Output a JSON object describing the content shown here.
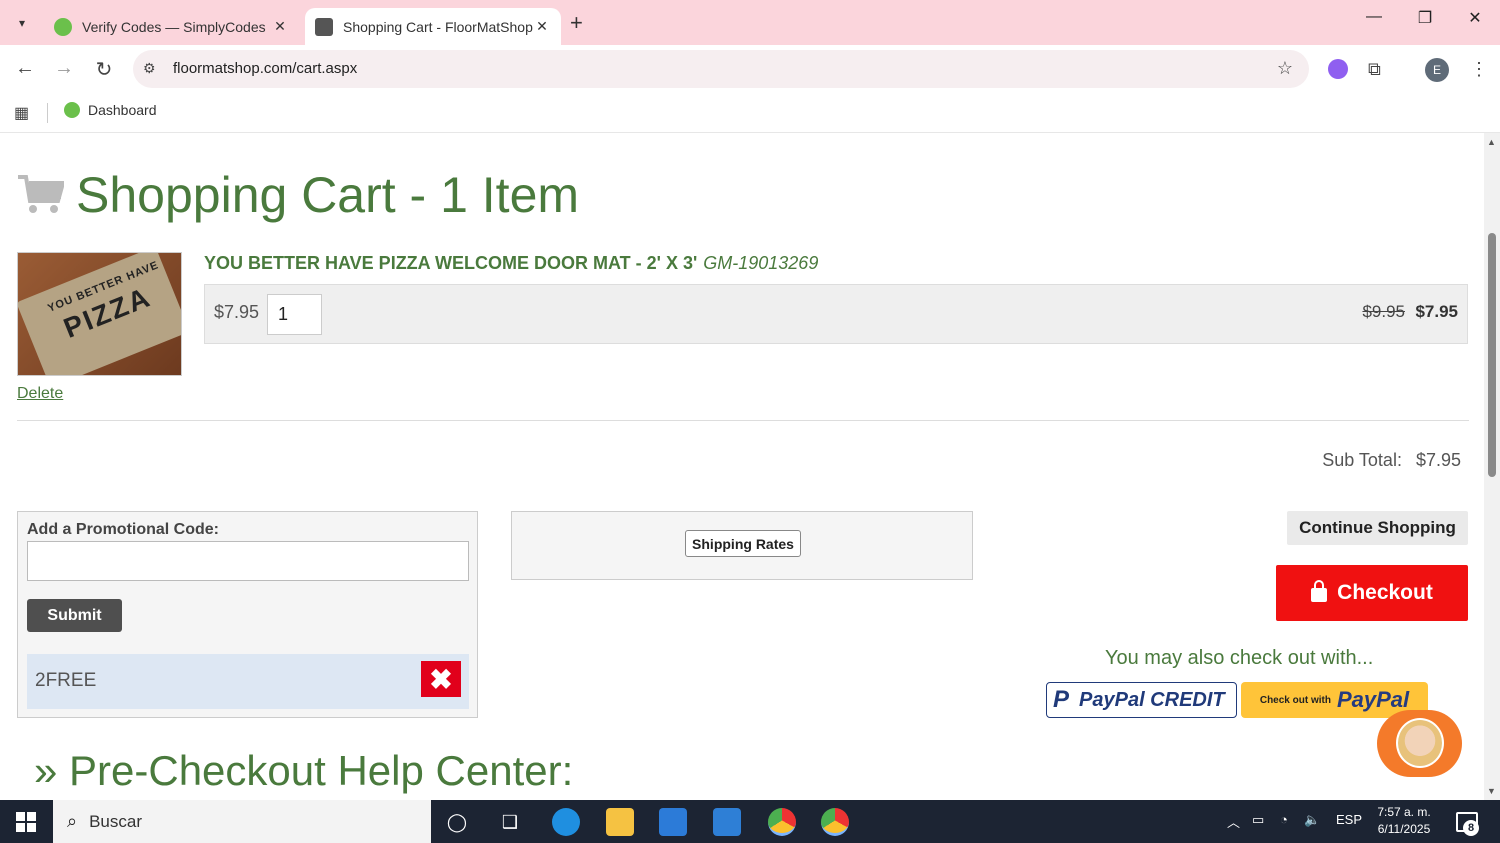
{
  "browser": {
    "tabs": [
      {
        "title": "Verify Codes — SimplyCodes",
        "active": false
      },
      {
        "title": "Shopping Cart - FloorMatShop",
        "active": true
      }
    ],
    "url": "floormatshop.com/cart.aspx",
    "bookmarks": [
      {
        "label": "Dashboard"
      }
    ],
    "avatar_letter": "E"
  },
  "cart": {
    "title": "Shopping Cart - 1 Item",
    "item": {
      "image_text_small": "YOU BETTER HAVE",
      "image_text_big": "PIZZA",
      "name": "YOU BETTER HAVE PIZZA WELCOME DOOR MAT - 2' X 3'",
      "sku": "GM-19013269",
      "unit_price": "$7.95",
      "quantity": "1",
      "original_price": "$9.95",
      "sale_price": "$7.95",
      "delete_label": "Delete"
    },
    "subtotal_label": "Sub Total:",
    "subtotal_value": "$7.95"
  },
  "promo": {
    "label": "Add a Promotional Code:",
    "input_value": "",
    "submit_label": "Submit",
    "applied_code": "2FREE",
    "remove_symbol": "✖"
  },
  "shipping": {
    "button_label": "Shipping Rates"
  },
  "actions": {
    "continue_label": "Continue Shopping",
    "checkout_label": "Checkout",
    "also_text": "You may also check out with...",
    "paypal_credit_p": "P",
    "paypal_credit_label": "PayPal CREDIT",
    "paypal_checkout_small": "Check out with",
    "paypal_checkout_brand": "PayPal"
  },
  "help": {
    "title": "» Pre-Checkout Help Center:"
  },
  "taskbar": {
    "search_placeholder": "Buscar",
    "language": "ESP",
    "time": "7:57 a. m.",
    "date": "6/11/2025",
    "notifications": "8"
  },
  "colors": {
    "brand_green": "#4a7a3d",
    "checkout_red": "#f01111",
    "paypal_yellow": "#ffc439",
    "tabbar_pink": "#fbd5dc"
  }
}
